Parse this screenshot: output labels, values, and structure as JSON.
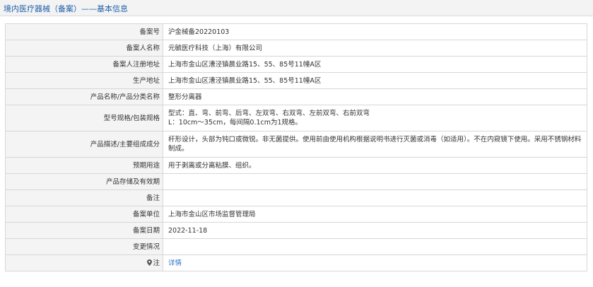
{
  "header": {
    "title": "境内医疗器械（备案）——基本信息"
  },
  "rows": [
    {
      "label": "备案号",
      "value": "沪金械备20220103"
    },
    {
      "label": "备案人名称",
      "value": "元毓医疗科技（上海）有限公司"
    },
    {
      "label": "备案人注册地址",
      "value": "上海市金山区漕泾镇晨业路15、55、85号11幢A区"
    },
    {
      "label": "生产地址",
      "value": "上海市金山区漕泾镇晨业路15、55、85号11幢A区"
    },
    {
      "label": "产品名称/产品分类名称",
      "value": "整形分离器"
    },
    {
      "label": "型号规格/包装规格",
      "line1": "型式：直、弯、前弯、后弯、左双弯、右双弯、左前双弯、右前双弯",
      "line2": "L：10cm～35cm，每间隔0.1cm为1规格。"
    },
    {
      "label": "产品描述/主要组成成分",
      "value": "杆形设计，头部为钝口或微锐。非无菌提供。使用前由使用机构根据说明书进行灭菌或消毒（如适用）。不在内窥镜下使用。采用不锈钢材料制成。"
    },
    {
      "label": "预期用途",
      "value": "用于剥离或分离粘膜、组织。"
    },
    {
      "label": "产品存储及有效期",
      "value": ""
    },
    {
      "label": "备注",
      "value": ""
    },
    {
      "label": "备案单位",
      "value": "上海市金山区市场监督管理局"
    },
    {
      "label": "备案日期",
      "value": "2022-11-18"
    },
    {
      "label": "变更情况",
      "value": ""
    },
    {
      "label": "注",
      "value": "详情",
      "icon": "location-pin-icon"
    }
  ],
  "colors": {
    "link": "#2a6fc0",
    "label_bg": "#f4f4f4",
    "border": "#d7d7d7"
  }
}
